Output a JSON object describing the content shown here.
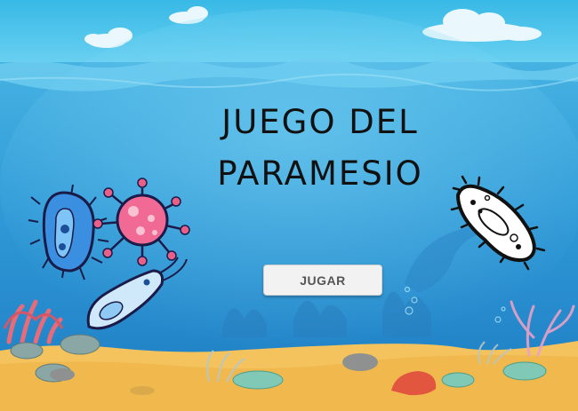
{
  "game": {
    "title_line1": "JUEGO DEL",
    "title_line2": "PARAMESIO",
    "play_button_label": "JUGAR"
  },
  "colors": {
    "sky_top": "#45c3ea",
    "sea_top": "#3aa8dc",
    "sea_bottom": "#1f7fc4",
    "sand": "#f4c35e",
    "button": "#f2f2f2"
  },
  "icons": [
    "bacillus-bacterium-icon",
    "virus-icon",
    "flagellate-microbe-icon",
    "paramecium-icon",
    "coral-icon",
    "rock-icon",
    "dolphin-silhouette-icon"
  ]
}
